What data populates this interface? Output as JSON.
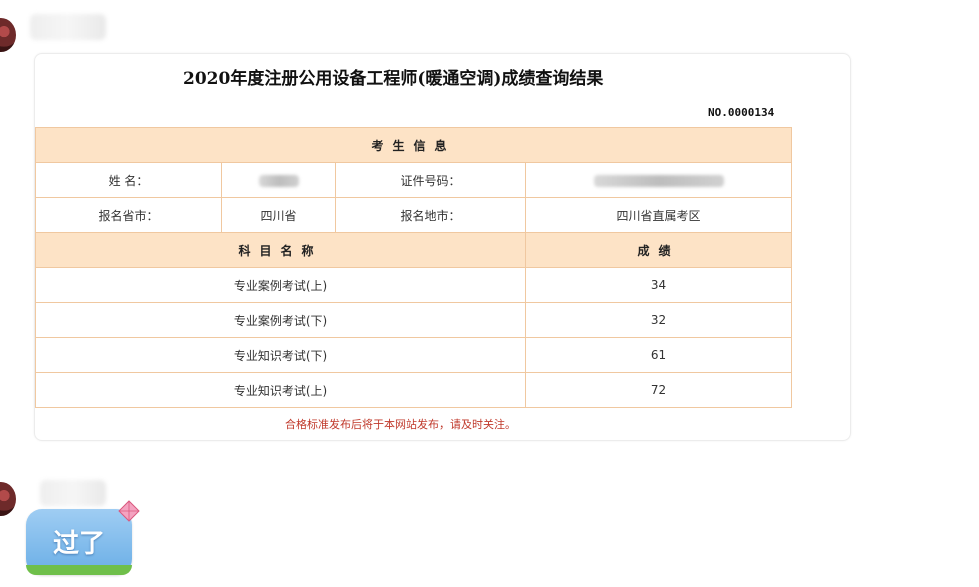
{
  "card": {
    "title": "2020年度注册公用设备工程师(暖通空调)成绩查询结果",
    "serial": "NO.0000134"
  },
  "info": {
    "section_header": "考生信息",
    "name_label": "姓 名：",
    "id_label": "证件号码：",
    "province_label": "报名省市：",
    "province_value": "四川省",
    "location_label": "报名地市：",
    "location_value": "四川省直属考区"
  },
  "scores": {
    "subject_header": "科目名称",
    "score_header": "成绩",
    "rows": [
      {
        "subject": "专业案例考试(上)",
        "score": "34"
      },
      {
        "subject": "专业案例考试(下)",
        "score": "32"
      },
      {
        "subject": "专业知识考试(下)",
        "score": "61"
      },
      {
        "subject": "专业知识考试(上)",
        "score": "72"
      }
    ]
  },
  "notice": "合格标准发布后将于本网站发布，请及时关注。",
  "chat": {
    "sticker_text": "过了"
  },
  "colors": {
    "header_bg": "#fde3c6",
    "border": "#f0c8a0",
    "notice": "#c0392b",
    "sticker": "#6aaee6"
  }
}
